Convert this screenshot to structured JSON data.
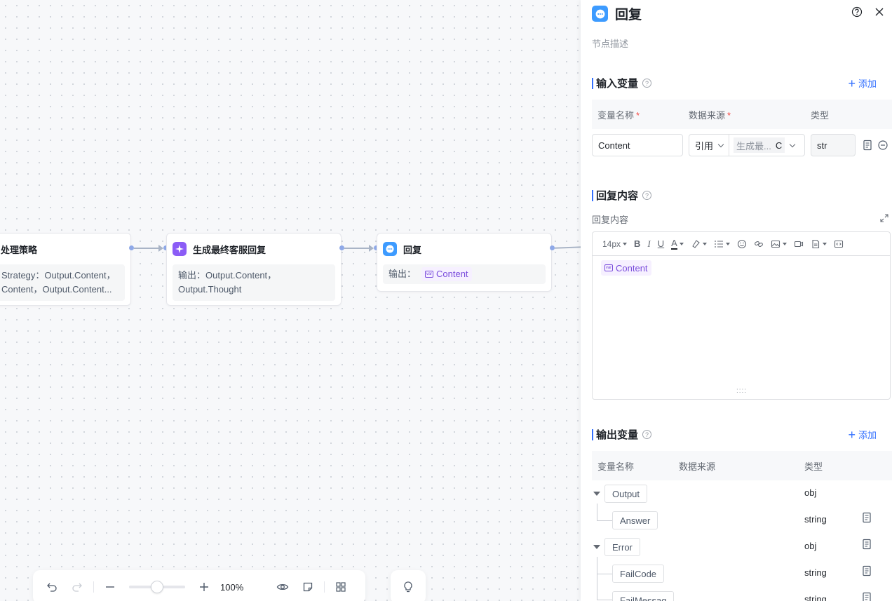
{
  "canvas": {
    "nodes": [
      {
        "id": "strategy",
        "title": "处理策略",
        "lines": [
          "Strategy：Output.Content，",
          "Content，Output.Content..."
        ]
      },
      {
        "id": "gen",
        "title": "生成最终客服回复",
        "lines": [
          "输出：Output.Content，",
          "Output.Thought"
        ]
      },
      {
        "id": "reply",
        "title": "回复",
        "output_label": "输出：",
        "output_var": "Content"
      }
    ]
  },
  "toolbar": {
    "zoom": "100%",
    "zoom_level": 0.5
  },
  "panel": {
    "title": "回复",
    "description_placeholder": "节点描述",
    "input_section": {
      "title": "输入变量",
      "add_label": "添加",
      "headers": {
        "name": "变量名称",
        "source": "数据来源",
        "type": "类型"
      },
      "row": {
        "name": "Content",
        "source_mode": "引用",
        "source_value": "生成最...",
        "source_suffix": "C",
        "type": "str"
      }
    },
    "reply_section": {
      "title": "回复内容",
      "sub_label": "回复内容",
      "font_size": "14px",
      "content_var": "Content"
    },
    "output_section": {
      "title": "输出变量",
      "add_label": "添加",
      "headers": {
        "name": "变量名称",
        "source": "数据来源",
        "type": "类型"
      },
      "rows": [
        {
          "name": "Output",
          "type": "obj"
        },
        {
          "name": "Answer",
          "type": "string"
        },
        {
          "name": "Error",
          "type": "obj"
        },
        {
          "name": "FailCode",
          "type": "string"
        },
        {
          "name": "FailMessag",
          "type": "string"
        }
      ]
    }
  },
  "colors": {
    "accent": "#3370ff",
    "reply_icon": "#3d9bff",
    "gen_icon": "#8b5cf6",
    "var_tag": "#7a4cdc"
  }
}
